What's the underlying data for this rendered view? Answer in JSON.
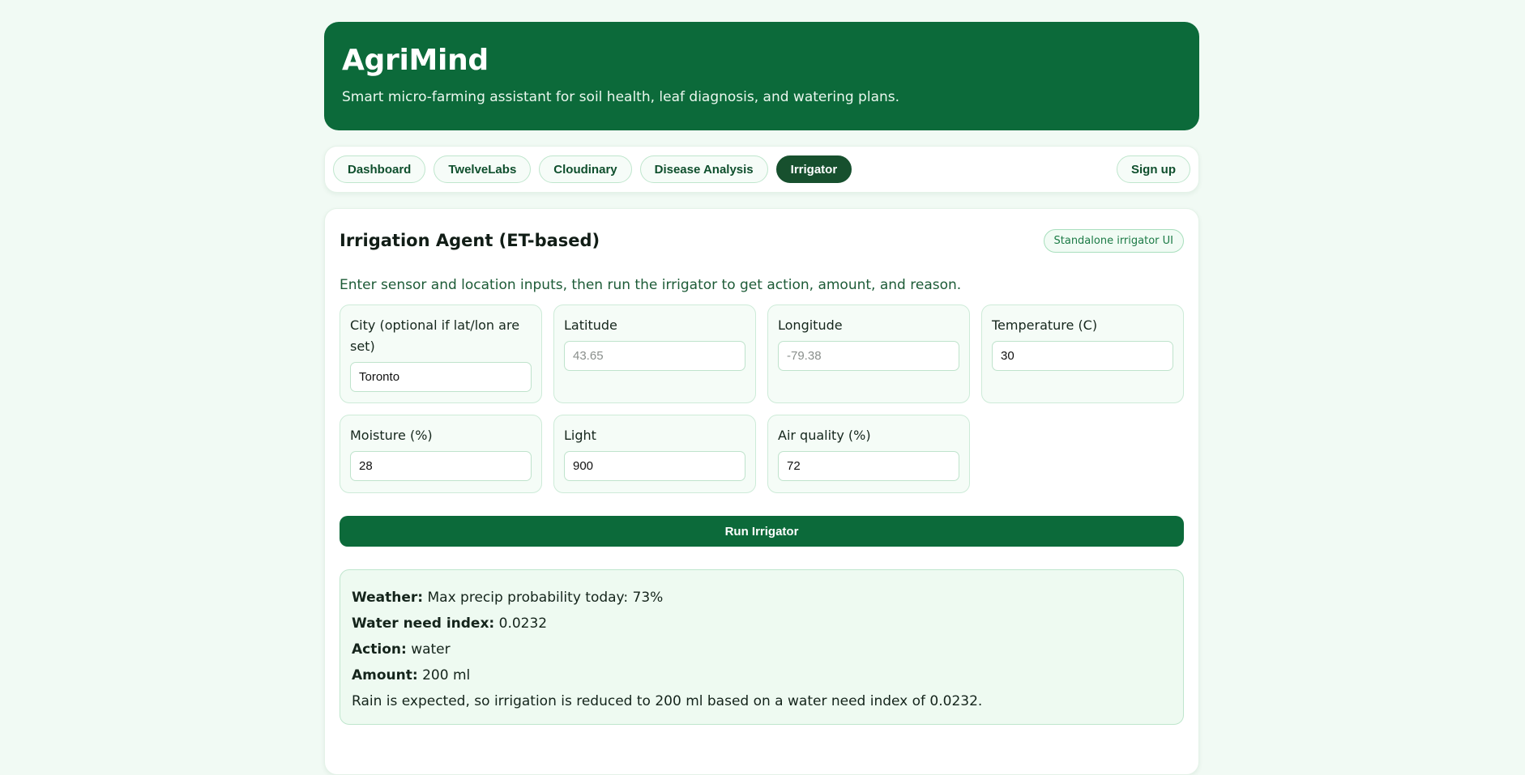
{
  "header": {
    "title": "AgriMind",
    "subtitle": "Smart micro-farming assistant for soil health, leaf diagnosis, and watering plans."
  },
  "nav": {
    "items": [
      {
        "label": "Dashboard",
        "active": false
      },
      {
        "label": "TwelveLabs",
        "active": false
      },
      {
        "label": "Cloudinary",
        "active": false
      },
      {
        "label": "Disease Analysis",
        "active": false
      },
      {
        "label": "Irrigator",
        "active": true
      }
    ],
    "signup_label": "Sign up"
  },
  "card": {
    "title": "Irrigation Agent (ET-based)",
    "badge": "Standalone irrigator UI",
    "description": "Enter sensor and location inputs, then run the irrigator to get action, amount, and reason."
  },
  "fields": {
    "city": {
      "label": "City (optional if lat/lon are set)",
      "value": "Toronto",
      "placeholder": ""
    },
    "latitude": {
      "label": "Latitude",
      "value": "",
      "placeholder": "43.65"
    },
    "longitude": {
      "label": "Longitude",
      "value": "",
      "placeholder": "-79.38"
    },
    "temperature": {
      "label": "Temperature (C)",
      "value": "30",
      "placeholder": ""
    },
    "moisture": {
      "label": "Moisture (%)",
      "value": "28",
      "placeholder": ""
    },
    "light": {
      "label": "Light",
      "value": "900",
      "placeholder": ""
    },
    "air_quality": {
      "label": "Air quality (%)",
      "value": "72",
      "placeholder": ""
    }
  },
  "run_button_label": "Run Irrigator",
  "result": {
    "weather_label": "Weather:",
    "weather_value": "Max precip probability today: 73%",
    "water_need_label": "Water need index:",
    "water_need_value": "0.0232",
    "action_label": "Action:",
    "action_value": "water",
    "amount_label": "Amount:",
    "amount_value": "200 ml",
    "reason": "Rain is expected, so irrigation is reduced to 200 ml based on a water need index of 0.0232."
  },
  "colors": {
    "brand": "#0c6a3a",
    "nav_active": "#17502e",
    "page_bg": "#f1faf4"
  }
}
